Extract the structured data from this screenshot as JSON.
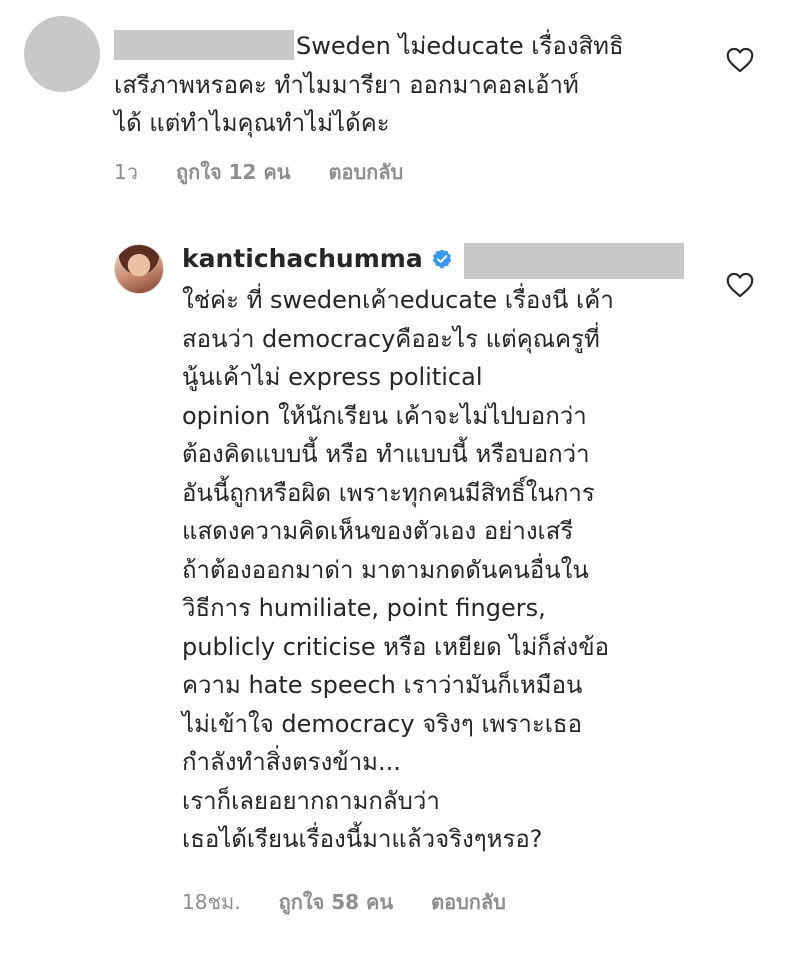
{
  "comments": [
    {
      "username": "",
      "lines": [
        "Sweden ไม่educate เรื่องสิทธิ",
        "เสรีภาพหรอคะ ทำไมมารียา ออกมาคอลเอ้าท์",
        "ได้ แต่ทำไมคุณทำไม่ได้คะ"
      ],
      "time": "1ว",
      "likes": "ถูกใจ 12 คน",
      "reply_label": "ตอบกลับ"
    },
    {
      "username": "kantichachumma",
      "lines": [
        "ใช่ค่ะ ที่ swedenเค้าeducate เรื่องนี เค้า",
        "สอนว่า democracyคืออะไร แต่คุณครูที่",
        "นู้นเค้าไม่ express political",
        "opinion ให้นักเรียน เค้าจะไม่ไปบอกว่า",
        "ต้องคิดแบบนี้ หรือ ทำแบบนี้ หรือบอกว่า",
        "อันนี้ถูกหรือผิด เพราะทุกคนมีสิทธิ์ในการ",
        "แสดงความคิดเห็นของตัวเอง อย่างเสรี",
        "ถ้าต้องออกมาด่า มาตามกดดันคนอื่นใน",
        "วิธีการ humiliate, point fingers,",
        "publicly criticise หรือ เหยียด ไม่ก็ส่งข้อ",
        "ความ hate speech เราว่ามันก็เหมือน",
        "ไม่เข้าใจ democracy จริงๆ เพราะเธอ",
        "กำลังทำสิ่งตรงข้าม...",
        "เราก็เลยอยากถามกลับว่า",
        "เธอได้เรียนเรื่องนี้มาแล้วจริงๆหรอ?"
      ],
      "time": "18ชม.",
      "likes": "ถูกใจ 58 คน",
      "reply_label": "ตอบกลับ"
    }
  ],
  "icons": {
    "like": "heart-outline-icon",
    "verified": "verified-badge-icon"
  },
  "colors": {
    "text": "#262626",
    "meta": "#8e8e8e",
    "redaction": "#c8c8c8",
    "verified": "#3897f0"
  }
}
